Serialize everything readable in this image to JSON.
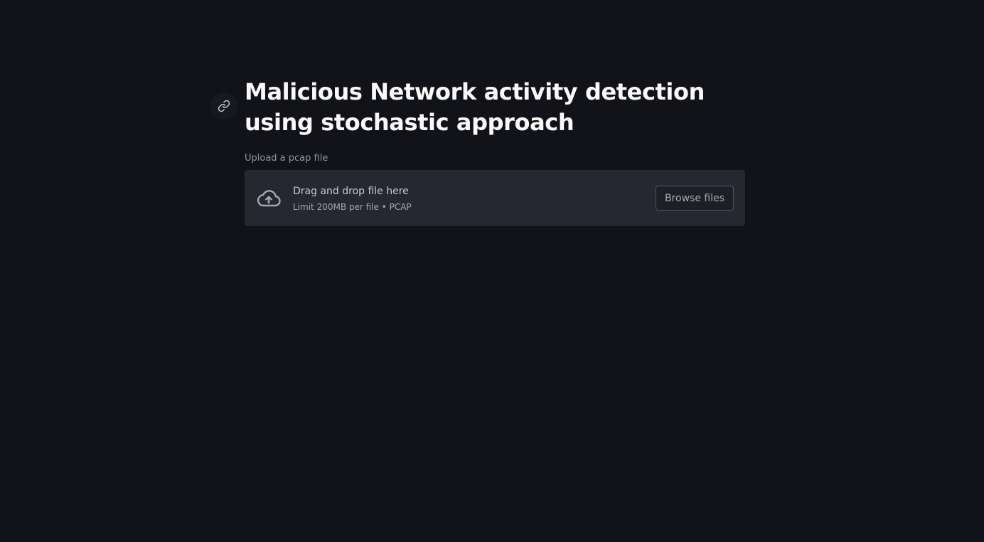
{
  "header": {
    "title": "Malicious Network activity detection using stochastic approach",
    "anchor_icon": "link-icon"
  },
  "uploader": {
    "label": "Upload a pcap file",
    "icon": "cloud-upload-icon",
    "instruction": "Drag and drop file here",
    "limit": "Limit 200MB per file • PCAP",
    "browse_label": "Browse files"
  },
  "colors": {
    "background": "#121318",
    "dropzone": "#262730",
    "text": "#fafafa"
  }
}
